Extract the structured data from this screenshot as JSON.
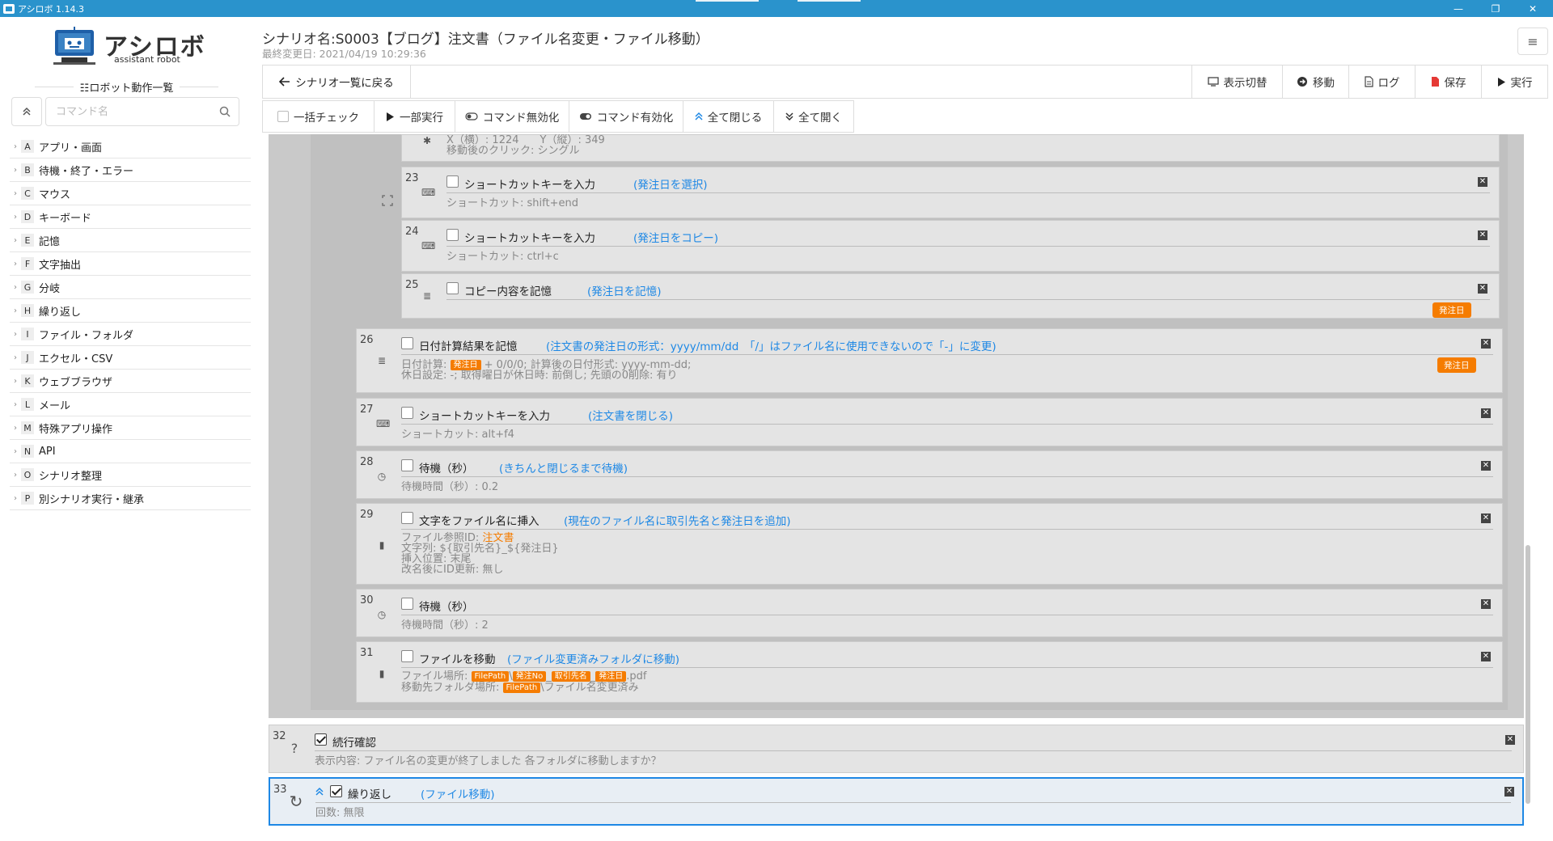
{
  "window": {
    "title": "アシロボ 1.14.3",
    "minimize": "—",
    "maximize": "❐",
    "close": "✕"
  },
  "logo": {
    "brand": "アシロボ",
    "sub": "assistant robot"
  },
  "sidebar": {
    "list_title": "☷ロボット動作一覧",
    "search_placeholder": "コマンド名",
    "collapse_icon": "chevron-up-double",
    "categories": [
      {
        "letter": "A",
        "label": "アプリ・画面"
      },
      {
        "letter": "B",
        "label": "待機・終了・エラー"
      },
      {
        "letter": "C",
        "label": "マウス"
      },
      {
        "letter": "D",
        "label": "キーボード"
      },
      {
        "letter": "E",
        "label": "記憶"
      },
      {
        "letter": "F",
        "label": "文字抽出"
      },
      {
        "letter": "G",
        "label": "分岐"
      },
      {
        "letter": "H",
        "label": "繰り返し"
      },
      {
        "letter": "I",
        "label": "ファイル・フォルダ"
      },
      {
        "letter": "J",
        "label": "エクセル・CSV"
      },
      {
        "letter": "K",
        "label": "ウェブブラウザ"
      },
      {
        "letter": "L",
        "label": "メール"
      },
      {
        "letter": "M",
        "label": "特殊アプリ操作"
      },
      {
        "letter": "N",
        "label": "API"
      },
      {
        "letter": "O",
        "label": "シナリオ整理"
      },
      {
        "letter": "P",
        "label": "別シナリオ実行・継承"
      }
    ]
  },
  "header": {
    "scenario_title": "シナリオ名:S0003【ブログ】注文書（ファイル名変更・ファイル移動）",
    "last_modified": "最終変更日: 2021/04/19 10:29:36",
    "menu_icon": "≡"
  },
  "toolbar": {
    "back": "シナリオ一覧に戻る",
    "view_toggle": "表示切替",
    "move": "移動",
    "log": "ログ",
    "save": "保存",
    "run": "実行"
  },
  "toolbar2": {
    "check_all": "一括チェック",
    "partial_run": "一部実行",
    "disable": "コマンド無効化",
    "enable": "コマンド有効化",
    "collapse_all": "全て閉じる",
    "expand_all": "全て開く"
  },
  "commands": {
    "c22": {
      "detail1": "X（横）: 1224　　Y（縦）: 349",
      "detail2": "移動後のクリック: シングル"
    },
    "c23": {
      "num": "23",
      "name": "ショートカットキーを入力",
      "memo": "(発注日を選択)",
      "detail": "ショートカット: shift+end"
    },
    "c24": {
      "num": "24",
      "name": "ショートカットキーを入力",
      "memo": "(発注日をコピー)",
      "detail": "ショートカット: ctrl+c"
    },
    "c25": {
      "num": "25",
      "name": "コピー内容を記憶",
      "memo": "(発注日を記憶)",
      "badge": "発注日"
    },
    "c26": {
      "num": "26",
      "name": "日付計算結果を記憶",
      "memo": "(注文書の発注日の形式：yyyy/mm/dd　「/」はファイル名に使用できないので「-」に変更)",
      "detail1_pre": "日付計算: ",
      "detail1_badge": "発注日",
      "detail1_post": " + 0/0/0; 計算後の日付形式: yyyy-mm-dd;",
      "detail2": "休日設定: -; 取得曜日が休日時: 前倒し; 先頭の0削除: 有り",
      "badge": "発注日"
    },
    "c27": {
      "num": "27",
      "name": "ショートカットキーを入力",
      "memo": "(注文書を閉じる)",
      "detail": "ショートカット: alt+f4"
    },
    "c28": {
      "num": "28",
      "name": "待機（秒）",
      "memo": "(きちんと閉じるまで待機)",
      "detail": "待機時間（秒）: 0.2"
    },
    "c29": {
      "num": "29",
      "name": "文字をファイル名に挿入",
      "memo": "(現在のファイル名に取引先名と発注日を追加)",
      "detail1_pre": "ファイル参照ID: ",
      "detail1_val": "注文書",
      "detail2": "文字列: ${取引先名}_${発注日}",
      "detail3": "挿入位置: 末尾",
      "detail4": "改名後にID更新: 無し"
    },
    "c30": {
      "num": "30",
      "name": "待機（秒）",
      "memo": "",
      "detail": "待機時間（秒）: 2"
    },
    "c31": {
      "num": "31",
      "name": "ファイルを移動",
      "memo": "(ファイル変更済みフォルダに移動)",
      "d1_pre": "ファイル場所: ",
      "b_filepath": "FilePath",
      "sep1": "\\",
      "b_order_no": "発注No",
      "sep2": "_",
      "b_client": "取引先名",
      "sep3": "_",
      "b_date": "発注日",
      "d1_post": ".pdf",
      "d2_pre": "移動先フォルダ場所: ",
      "d2_post": "\\ファイル名変更済み"
    },
    "c32": {
      "num": "32",
      "name": "続行確認",
      "memo": "",
      "detail": "表示内容: ファイル名の変更が終了しました 各フォルダに移動しますか？"
    },
    "c33": {
      "num": "33",
      "name": "繰り返し",
      "memo": "(ファイル移動)",
      "detail": "回数: 無限"
    }
  },
  "colors": {
    "titlebar": "#2a93cc",
    "memo": "#1e88e5",
    "badge": "#f57c00",
    "save_icon": "#e53935"
  }
}
